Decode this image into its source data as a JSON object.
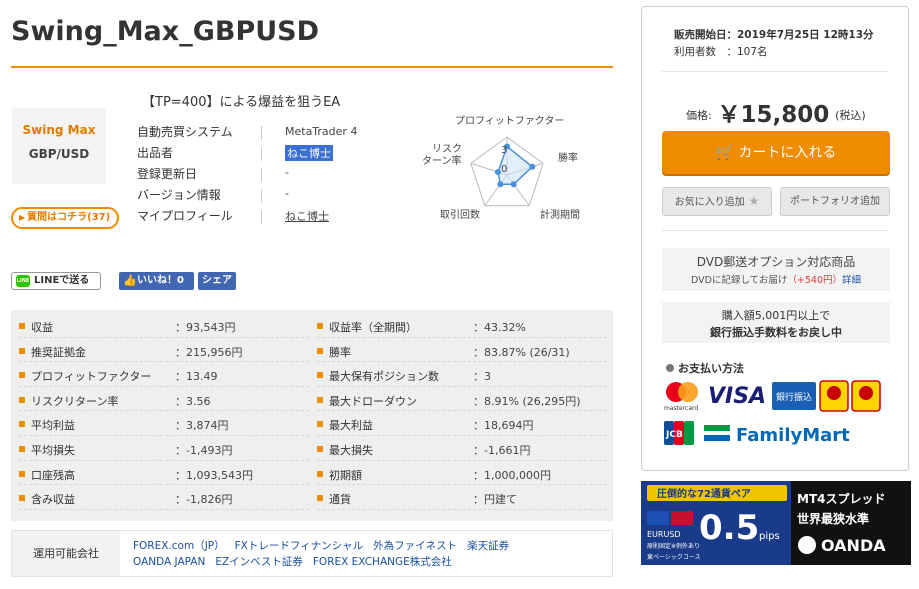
{
  "product": {
    "title": "Swing_Max_GBPUSD",
    "tagline": "【TP=400】による爆益を狙うEA",
    "logo_line1": "Swing Max",
    "logo_line2": "GBP/USD",
    "qa_button": "質問はコチラ(37)"
  },
  "info": [
    {
      "key": "自動売買システム",
      "value": "MetaTrader 4"
    },
    {
      "key": "出品者",
      "value": "ねこ博士"
    },
    {
      "key": "登録更新日",
      "value": "-"
    },
    {
      "key": "バージョン情報",
      "value": "-"
    },
    {
      "key": "マイプロフィール",
      "value": "ねこ博士"
    }
  ],
  "radar": {
    "axes": [
      "プロフィットファクター",
      "勝率",
      "計測期間",
      "取引回数",
      "リスク\nリターン率"
    ],
    "axis_labels": {
      "pf": "プロフィットファクター",
      "win": "勝率",
      "period": "計測期間",
      "trades": "取引回数",
      "risk1": "リスク",
      "risk2": "ターン率"
    },
    "tick_3": "3",
    "tick_0": "0",
    "values": [
      0.75,
      0.7,
      0.3,
      0.3,
      0.25
    ],
    "colors": {
      "line": "#4a90d9",
      "fill": "#cfe2f6",
      "grid": "#bbbbbb"
    }
  },
  "social": {
    "line_label": "LINEで送る",
    "line_icon_text": "LINE",
    "like_label": "いいね！0",
    "share_label": "シェア"
  },
  "stats_left": [
    {
      "key": "収益",
      "value": "：93,543円"
    },
    {
      "key": "推奨証拠金",
      "value": "：215,956円"
    },
    {
      "key": "プロフィットファクター",
      "value": "：13.49"
    },
    {
      "key": "リスクリターン率",
      "value": "：3.56"
    },
    {
      "key": "平均利益",
      "value": "：3,874円"
    },
    {
      "key": "平均損失",
      "value": "：-1,493円"
    },
    {
      "key": "口座残高",
      "value": "：1,093,543円"
    },
    {
      "key": "含み収益",
      "value": "：-1,826円"
    }
  ],
  "stats_right": [
    {
      "key": "収益率（全期間）",
      "value": "：43.32%"
    },
    {
      "key": "勝率",
      "value": "：83.87% (26/31)"
    },
    {
      "key": "最大保有ポジション数",
      "value": "：3"
    },
    {
      "key": "最大ドローダウン",
      "value": "：8.91% (26,295円)"
    },
    {
      "key": "最大利益",
      "value": "：18,694円"
    },
    {
      "key": "最大損失",
      "value": "：-1,661円"
    },
    {
      "key": "初期額",
      "value": "：1,000,000円"
    },
    {
      "key": "通貨",
      "value": "：円建て"
    }
  ],
  "brokers": {
    "label": "運用可能会社",
    "items": [
      "FOREX.com（JP）",
      "FXトレードフィナンシャル",
      "外為ファイネスト",
      "楽天証券",
      "OANDA JAPAN",
      "EZインベスト証券",
      "FOREX EXCHANGE株式会社"
    ]
  },
  "sidebar": {
    "sale_start_label": "販売開始日：",
    "sale_start_value": "2019年7月25日 12時13分",
    "users_label": "利用者数　：",
    "users_value": "107名",
    "price_label": "価格:",
    "price_value": "￥15,800",
    "price_tax": "(税込)",
    "cart_button": "カートに入れる",
    "favorite_button": "お気に入り追加",
    "portfolio_button": "ポートフォリオ追加",
    "dvd_title": "DVD郵送オプション対応商品",
    "dvd_desc": "DVDに記録してお届け",
    "dvd_price": "（+540円）",
    "dvd_detail": "詳細",
    "bank_line1": "購入額5,001円以上で",
    "bank_line2": "銀行振込手数料をお戻し中",
    "pay_title": "お支払い方法",
    "mastercard_text": "mastercard",
    "visa_text": "VISA",
    "bank_transfer_text": "銀行振込",
    "jcb_text": "JCB",
    "familymart_text": "FamilyMart"
  },
  "banner": {
    "top_text": "圧倒的な72通貨ペア",
    "pair_text": "EURUSD",
    "spread_value": "0.5",
    "spread_unit": "pips",
    "note_text": "原則固定※例外あり",
    "course_text": "東ベーシックコース",
    "right_line1": "MT4スプレッド",
    "right_line2": "世界最狭水準",
    "brand_text": "OANDA"
  },
  "colors": {
    "accent": "#f08c00",
    "link": "#1a4fa0",
    "facebook": "#4267b2",
    "line": "#2ec400"
  }
}
